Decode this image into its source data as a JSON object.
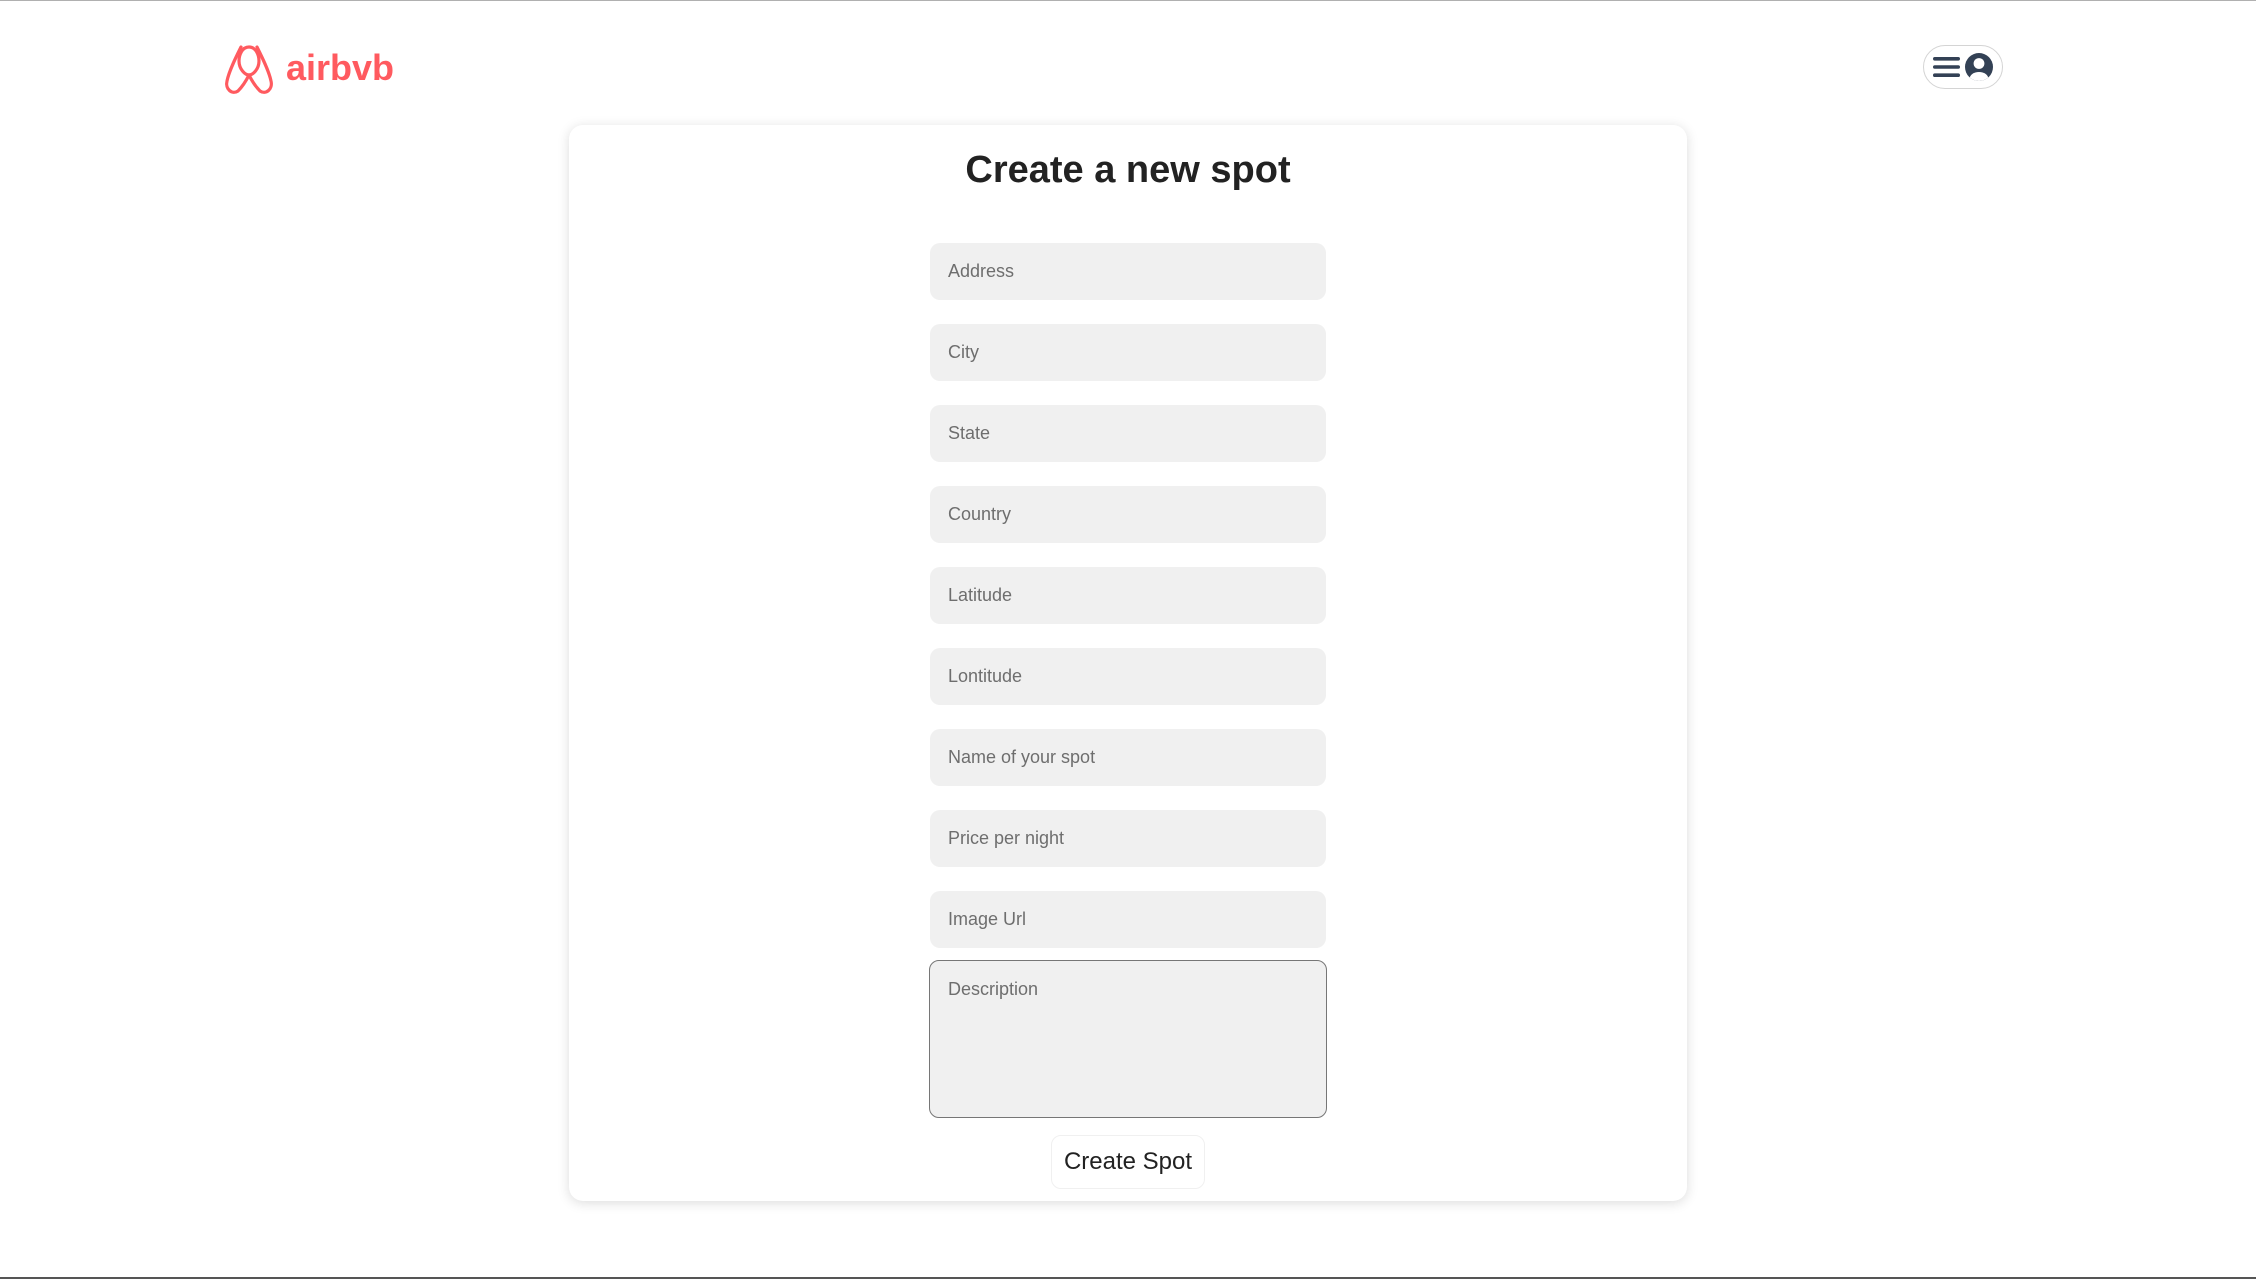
{
  "brand": {
    "name": "airbvb",
    "logo_icon": "airbnb-belo-icon",
    "color": "#ff5a5f"
  },
  "header": {
    "menu_icon": "hamburger-menu-icon",
    "profile_icon": "user-circle-icon",
    "icon_color": "#334155"
  },
  "form": {
    "title": "Create a new spot",
    "fields": {
      "address": {
        "placeholder": "Address",
        "value": ""
      },
      "city": {
        "placeholder": "City",
        "value": ""
      },
      "state": {
        "placeholder": "State",
        "value": ""
      },
      "country": {
        "placeholder": "Country",
        "value": ""
      },
      "latitude": {
        "placeholder": "Latitude",
        "value": ""
      },
      "longitude": {
        "placeholder": "Lontitude",
        "value": ""
      },
      "name": {
        "placeholder": "Name of your spot",
        "value": ""
      },
      "price": {
        "placeholder": "Price per night",
        "value": ""
      },
      "image_url": {
        "placeholder": "Image Url",
        "value": ""
      },
      "description": {
        "placeholder": "Description",
        "value": ""
      }
    },
    "submit_label": "Create Spot",
    "field_background": "#f0f0f0"
  }
}
